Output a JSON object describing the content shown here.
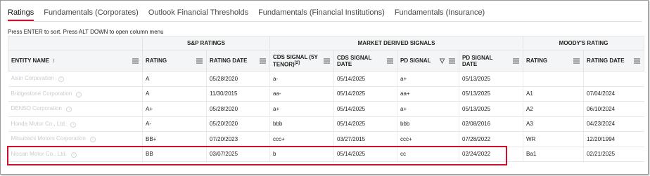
{
  "tabs": [
    "Ratings",
    "Fundamentals (Corporates)",
    "Outlook Financial Thresholds",
    "Fundamentals (Financial Institutions)",
    "Fundamentals (Insurance)"
  ],
  "hint": "Press ENTER to sort. Press ALT DOWN to open column menu",
  "groups": {
    "sp": "S&P RATINGS",
    "market": "MARKET DERIVED SIGNALS",
    "moodys": "MOODY'S RATING"
  },
  "columns": {
    "entity": "ENTITY NAME",
    "entity_sort": "↑",
    "sp_rating": "RATING",
    "sp_date": "RATING DATE",
    "cds_signal": "CDS SIGNAL (5Y TENOR)",
    "cds_signal_sup": "[2]",
    "cds_date": "CDS SIGNAL DATE",
    "pd_signal": "PD SIGNAL",
    "pd_date": "PD SIGNAL DATE",
    "m_rating": "RATING",
    "m_date": "RATING DATE"
  },
  "rows": [
    {
      "entity": "Aisin Corporation",
      "sp_rating": "A",
      "sp_date": "05/28/2020",
      "cds": "a-",
      "cds_date": "05/14/2025",
      "pd": "a+",
      "pd_date": "05/13/2025",
      "m_rating": "",
      "m_date": ""
    },
    {
      "entity": "Bridgestone Corporation",
      "sp_rating": "A",
      "sp_date": "11/30/2015",
      "cds": "aa-",
      "cds_date": "05/14/2025",
      "pd": "aa+",
      "pd_date": "05/13/2025",
      "m_rating": "A1",
      "m_date": "07/04/2024"
    },
    {
      "entity": "DENSO Corporation",
      "sp_rating": "A+",
      "sp_date": "05/28/2020",
      "cds": "a+",
      "cds_date": "05/14/2025",
      "pd": "a+",
      "pd_date": "05/13/2025",
      "m_rating": "A2",
      "m_date": "06/10/2024"
    },
    {
      "entity": "Honda Motor Co., Ltd.",
      "sp_rating": "A-",
      "sp_date": "05/20/2020",
      "cds": "bbb",
      "cds_date": "05/14/2025",
      "pd": "bbb",
      "pd_date": "02/08/2016",
      "m_rating": "A3",
      "m_date": "04/23/2024"
    },
    {
      "entity": "Mitsubishi Motors Corporation",
      "sp_rating": "BB+",
      "sp_date": "07/20/2023",
      "cds": "ccc+",
      "cds_date": "03/27/2015",
      "pd": "ccc+",
      "pd_date": "07/28/2022",
      "m_rating": "WR",
      "m_date": "12/20/1994"
    },
    {
      "entity": "Nissan Motor Co., Ltd.",
      "sp_rating": "BB",
      "sp_date": "03/07/2025",
      "cds": "b",
      "cds_date": "05/14/2025",
      "pd": "cc",
      "pd_date": "02/24/2022",
      "m_rating": "Ba1",
      "m_date": "02/21/2025"
    }
  ]
}
